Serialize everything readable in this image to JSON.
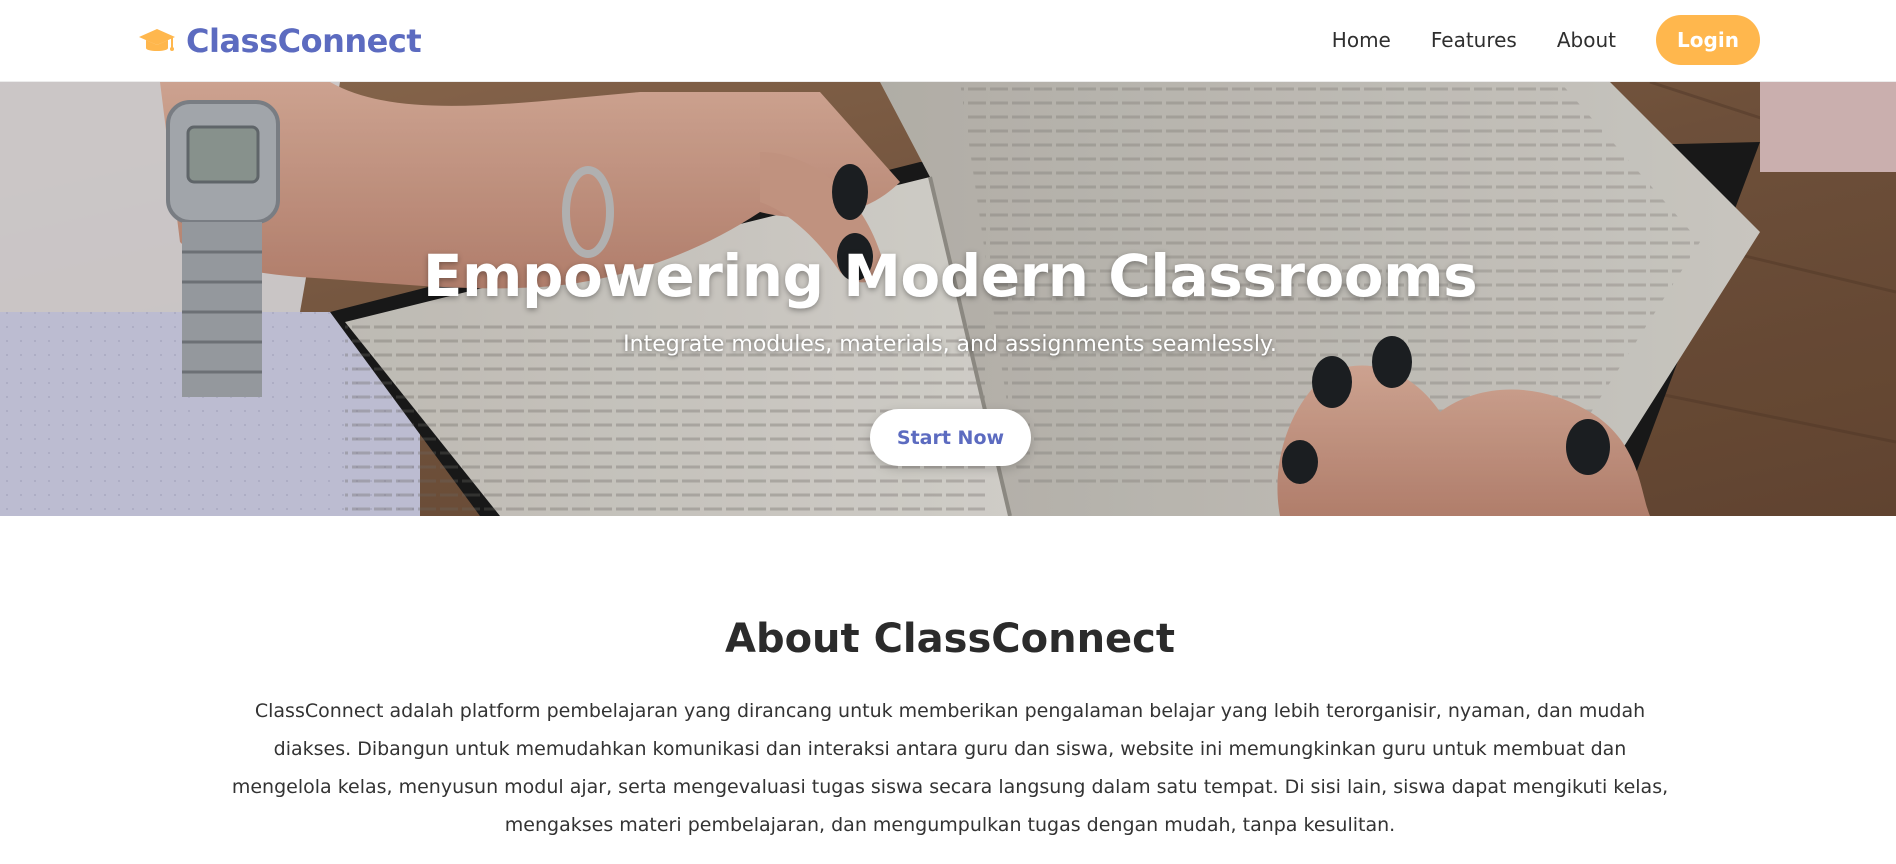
{
  "brand": {
    "name": "ClassConnect",
    "icon": "graduation-cap-icon",
    "color": "#5c6bc0",
    "icon_color": "#ffb74d"
  },
  "nav": {
    "links": [
      {
        "label": "Home"
      },
      {
        "label": "Features"
      },
      {
        "label": "About"
      }
    ],
    "login_label": "Login",
    "login_color": "#ffb74d"
  },
  "hero": {
    "title": "Empowering Modern Classrooms",
    "subtitle": "Integrate modules, materials, and assignments seamlessly.",
    "cta_label": "Start Now",
    "background": "photo of hands holding an open book"
  },
  "about": {
    "title": "About ClassConnect",
    "text": "ClassConnect adalah platform pembelajaran yang dirancang untuk memberikan pengalaman belajar yang lebih terorganisir, nyaman, dan mudah diakses. Dibangun untuk memudahkan komunikasi dan interaksi antara guru dan siswa, website ini memungkinkan guru untuk membuat dan mengelola kelas, menyusun modul ajar, serta mengevaluasi tugas siswa secara langsung dalam satu tempat. Di sisi lain, siswa dapat mengikuti kelas, mengakses materi pembelajaran, dan mengumpulkan tugas dengan mudah, tanpa kesulitan."
  }
}
